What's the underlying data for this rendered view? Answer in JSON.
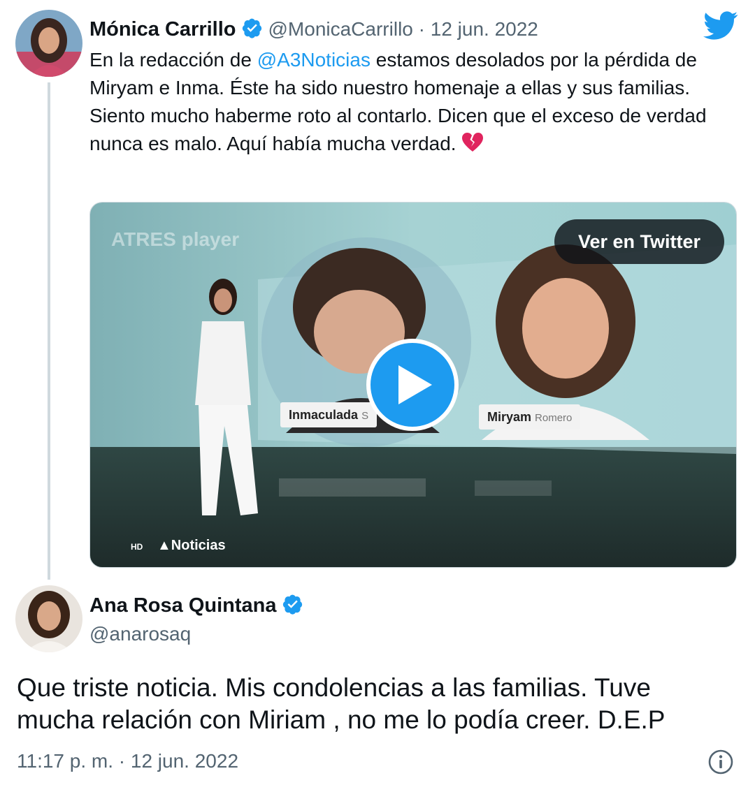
{
  "colors": {
    "accent": "#1d9bf0",
    "text": "#0f1419",
    "secondary": "#536471",
    "thread_line": "#cfd9de"
  },
  "icons": {
    "brand": "twitter-bird-icon",
    "verified": "verified-badge-icon",
    "play": "play-icon",
    "info": "info-icon",
    "emoji": "broken-heart-icon"
  },
  "tweet1": {
    "author_name": "Mónica Carrillo",
    "handle_and_date": "@MonicaCarrillo · 12 jun. 2022",
    "text_before_mention": "En la redacción de ",
    "mention": "@A3Noticias",
    "text_after_mention": " estamos desolados por la pérdida de Miryam e Inma. Éste ha sido nuestro homenaje a ellas y sus familias.",
    "text_line2": "Siento mucho haberme roto al contarlo. Dicen que el exceso de verdad nunca es malo. Aquí había mucha verdad.",
    "emoji": "💔",
    "media": {
      "view_button": "Ver en Twitter",
      "watermark": "ATRES player",
      "label_left": "Inmaculada",
      "label_left_extra": "S",
      "label_right": "Miryam",
      "label_right_extra": "Romero",
      "hd_badge": "HD",
      "channel": "Noticias"
    }
  },
  "tweet2": {
    "author_name": "Ana Rosa Quintana",
    "handle": "@anarosaq",
    "text": "Que triste noticia. Mis condolencias a las familias. Tuve mucha relación con Miriam , no me lo podía creer. D.E.P",
    "timestamp": "11:17 p. m. · 12 jun. 2022"
  }
}
